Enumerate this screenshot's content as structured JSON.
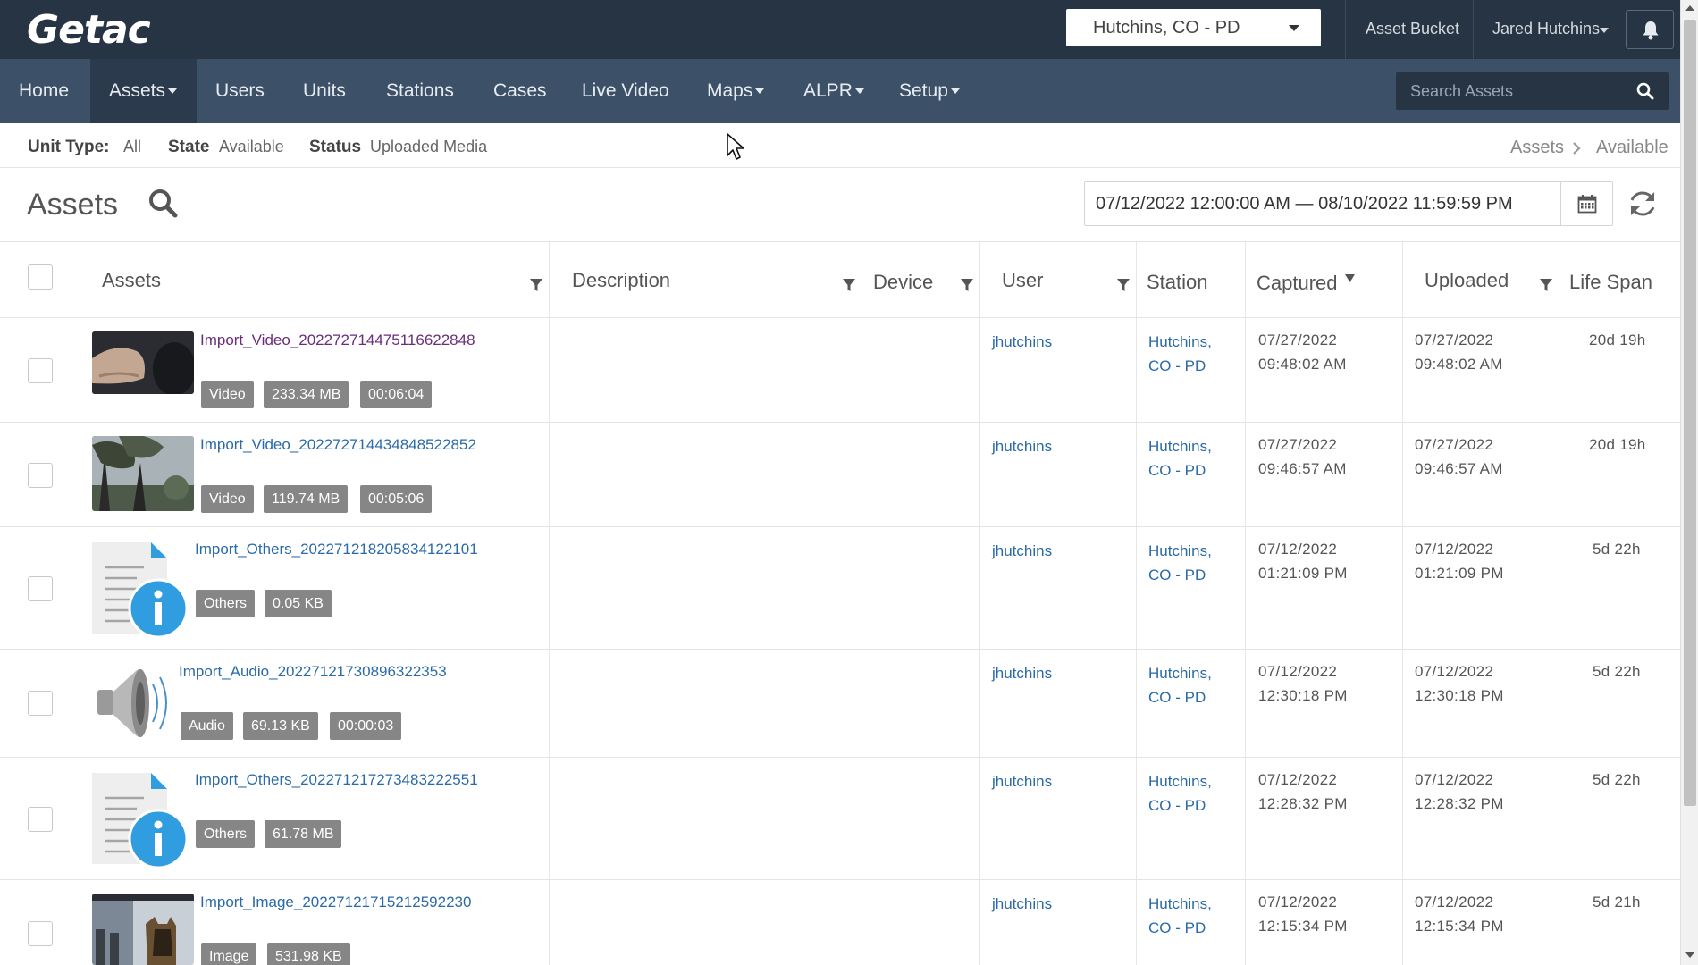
{
  "app": {
    "logo": "Getac"
  },
  "topbar": {
    "agency": "Hutchins, CO - PD",
    "asset_bucket": "Asset Bucket",
    "user": "Jared Hutchins"
  },
  "nav": {
    "items": [
      {
        "label": "Home"
      },
      {
        "label": "Assets"
      },
      {
        "label": "Users"
      },
      {
        "label": "Units"
      },
      {
        "label": "Stations"
      },
      {
        "label": "Cases"
      },
      {
        "label": "Live Video"
      },
      {
        "label": "Maps"
      },
      {
        "label": "ALPR"
      },
      {
        "label": "Setup"
      }
    ],
    "search_placeholder": "Search Assets"
  },
  "filters": {
    "unit_type_label": "Unit Type:",
    "unit_type_value": "All",
    "state_label": "State",
    "state_value": "Available",
    "status_label": "Status",
    "status_value": "Uploaded Media"
  },
  "breadcrumb": {
    "root": "Assets",
    "current": "Available"
  },
  "assets_panel": {
    "title": "Assets",
    "date_from": "07/12/2022 12:00:00 AM",
    "date_sep": "—",
    "date_to": "08/10/2022 11:59:59 PM"
  },
  "table": {
    "columns": {
      "assets": "Assets",
      "description": "Description",
      "device": "Device",
      "user": "User",
      "station": "Station",
      "captured": "Captured",
      "uploaded": "Uploaded",
      "life_span": "Life Span"
    },
    "rows": [
      {
        "name": "Import_Video_202272714475116622848",
        "type": "Video",
        "size": "233.34 MB",
        "duration": "00:06:04",
        "description": "",
        "device": "",
        "user": "jhutchins",
        "station": "Hutchins, CO - PD",
        "captured_date": "07/27/2022",
        "captured_time": "09:48:02 AM",
        "uploaded_date": "07/27/2022",
        "uploaded_time": "09:48:02 AM",
        "life_span": "20d 19h"
      },
      {
        "name": "Import_Video_202272714434848522852",
        "type": "Video",
        "size": "119.74 MB",
        "duration": "00:05:06",
        "description": "",
        "device": "",
        "user": "jhutchins",
        "station": "Hutchins, CO - PD",
        "captured_date": "07/27/2022",
        "captured_time": "09:46:57 AM",
        "uploaded_date": "07/27/2022",
        "uploaded_time": "09:46:57 AM",
        "life_span": "20d 19h"
      },
      {
        "name": "Import_Others_202271218205834122101",
        "type": "Others",
        "size": "0.05 KB",
        "duration": "",
        "description": "",
        "device": "",
        "user": "jhutchins",
        "station": "Hutchins, CO - PD",
        "captured_date": "07/12/2022",
        "captured_time": "01:21:09 PM",
        "uploaded_date": "07/12/2022",
        "uploaded_time": "01:21:09 PM",
        "life_span": "5d 22h"
      },
      {
        "name": "Import_Audio_20227121730896322353",
        "type": "Audio",
        "size": "69.13 KB",
        "duration": "00:00:03",
        "description": "",
        "device": "",
        "user": "jhutchins",
        "station": "Hutchins, CO - PD",
        "captured_date": "07/12/2022",
        "captured_time": "12:30:18 PM",
        "uploaded_date": "07/12/2022",
        "uploaded_time": "12:30:18 PM",
        "life_span": "5d 22h"
      },
      {
        "name": "Import_Others_202271217273483222551",
        "type": "Others",
        "size": "61.78 MB",
        "duration": "",
        "description": "",
        "device": "",
        "user": "jhutchins",
        "station": "Hutchins, CO - PD",
        "captured_date": "07/12/2022",
        "captured_time": "12:28:32 PM",
        "uploaded_date": "07/12/2022",
        "uploaded_time": "12:28:32 PM",
        "life_span": "5d 22h"
      },
      {
        "name": "Import_Image_20227121715212592230",
        "type": "Image",
        "size": "531.98 KB",
        "duration": "",
        "description": "",
        "device": "",
        "user": "jhutchins",
        "station": "Hutchins, CO - PD",
        "captured_date": "07/12/2022",
        "captured_time": "12:15:34 PM",
        "uploaded_date": "07/12/2022",
        "uploaded_time": "12:15:34 PM",
        "life_span": "5d 21h"
      }
    ]
  },
  "icons": {
    "search": "search-icon",
    "bell": "bell-icon",
    "calendar": "calendar-icon",
    "refresh": "refresh-icon",
    "filter": "filter-icon",
    "info": "info-icon",
    "speaker": "speaker-icon"
  },
  "colors": {
    "topbar": "#263444",
    "navbar": "#3c5068",
    "link": "#2a6aa8",
    "visited_link": "#6a2d7a",
    "badge": "#868686",
    "info_blue": "#2f9de0"
  }
}
